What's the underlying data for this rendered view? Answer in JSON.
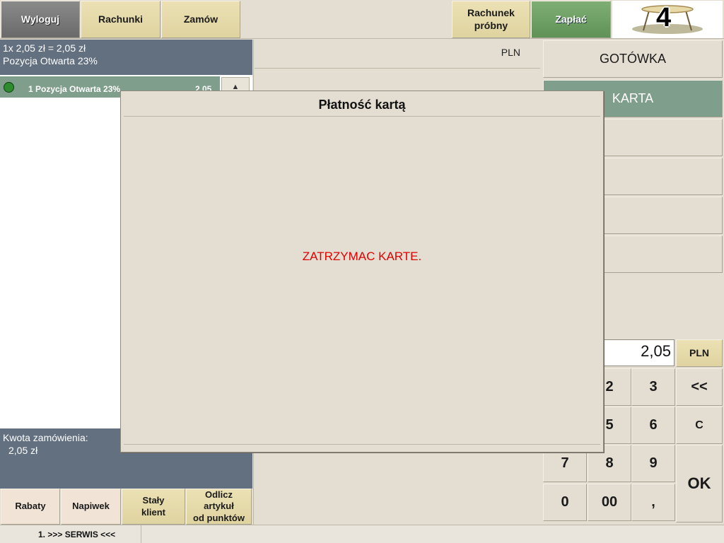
{
  "topbar": {
    "logout": "Wyloguj",
    "bills": "Rachunki",
    "order": "Zamów",
    "proforma_line1": "Rachunek",
    "proforma_line2": "próbny",
    "pay": "Zapłać",
    "table_number": "4"
  },
  "order_info": {
    "line1": "1x 2,05 zł =  2,05 zł",
    "line2": "Pozycja Otwarta 23%"
  },
  "order_items": [
    {
      "label": "1 Pozycja Otwarta 23%",
      "price": "2,05"
    }
  ],
  "order_total": {
    "label": "Kwota zamówienia:",
    "value": "2,05 zł"
  },
  "bottom_buttons": {
    "discounts": "Rabaty",
    "tip": "Napiwek",
    "regular_client_line1": "Stały",
    "regular_client_line2": "klient",
    "points_line1": "Odlicz",
    "points_line2": "artykuł",
    "points_line3": "od punktów"
  },
  "middle": {
    "currency": "PLN"
  },
  "payment_methods": {
    "cash": "GOTÓWKA",
    "card": "KARTA"
  },
  "keypad": {
    "amount": "2,05",
    "currency": "PLN",
    "k2": "2",
    "k3": "3",
    "back": "<<",
    "k5": "5",
    "k6": "6",
    "clear": "C",
    "k7": "7",
    "k8": "8",
    "k9": "9",
    "k0": "0",
    "k00": "00",
    "comma": ",",
    "ok": "OK"
  },
  "status_bar": {
    "text": "1. >>> SERWIS <<<"
  },
  "modal": {
    "title": "Płatność kartą",
    "message": "ZATRZYMAC KARTE."
  },
  "colors": {
    "accent_green": "#7fae74",
    "info_panel": "#637080",
    "message_red": "#e00000"
  }
}
